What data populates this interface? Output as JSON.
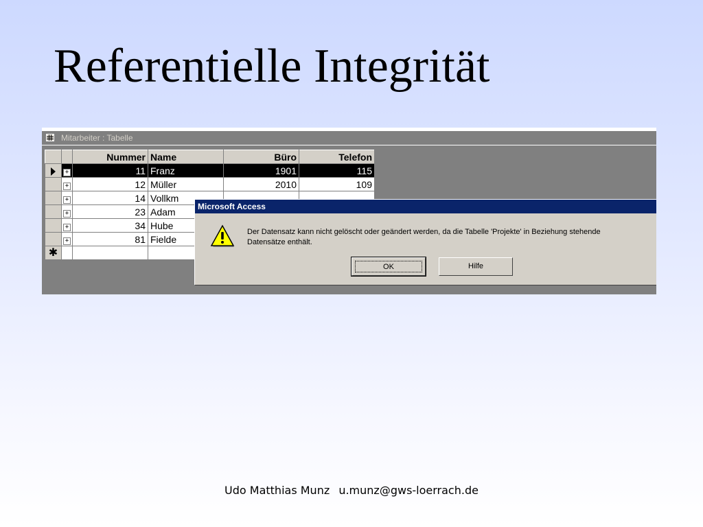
{
  "slide": {
    "title": "Referentielle Integrität",
    "footer_author": "Udo Matthias Munz",
    "footer_email": "u.munz@gws-loerrach.de"
  },
  "window": {
    "title": "Mitarbeiter : Tabelle"
  },
  "table": {
    "columns": [
      "Nummer",
      "Name",
      "Büro",
      "Telefon"
    ],
    "rows": [
      {
        "nummer": "11",
        "name": "Franz",
        "buero": "1901",
        "telefon": "115",
        "current": true
      },
      {
        "nummer": "12",
        "name": "Müller",
        "buero": "2010",
        "telefon": "109",
        "current": false
      },
      {
        "nummer": "14",
        "name": "Vollkm",
        "buero": "",
        "telefon": "",
        "current": false
      },
      {
        "nummer": "23",
        "name": "Adam",
        "buero": "",
        "telefon": "",
        "current": false
      },
      {
        "nummer": "34",
        "name": "Hube",
        "buero": "",
        "telefon": "",
        "current": false
      },
      {
        "nummer": "81",
        "name": "Fielde",
        "buero": "",
        "telefon": "",
        "current": false
      }
    ],
    "expand_symbol": "+",
    "new_record_symbol": "✱"
  },
  "dialog": {
    "title": "Microsoft Access",
    "message_line1": "Der Datensatz kann nicht gelöscht oder geändert werden, da die Tabelle 'Projekte' in Beziehung stehende",
    "message_line2": "Datensätze enthält.",
    "ok_label": "OK",
    "help_label": "Hilfe",
    "close_symbol": "×",
    "icon": "warning-icon"
  },
  "colors": {
    "dialog_title_bar": "#0a246a",
    "window_face": "#d4d0c8",
    "warning_yellow": "#ffff00"
  }
}
